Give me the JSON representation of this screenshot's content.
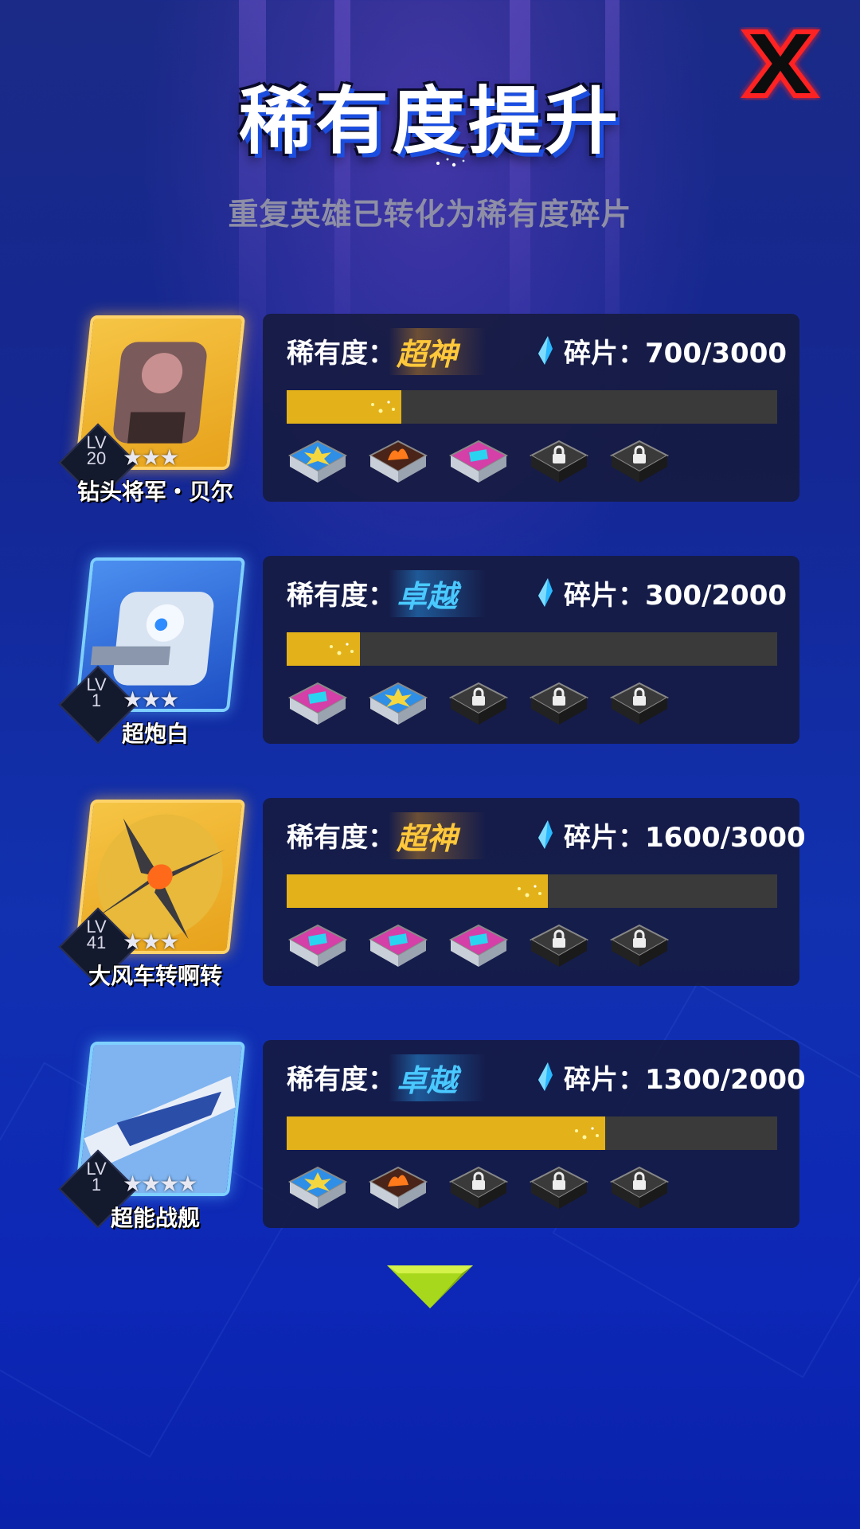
{
  "header": {
    "title": "稀有度提升",
    "subtitle": "重复英雄已转化为稀有度碎片",
    "close_icon": "close-x-icon"
  },
  "colors": {
    "accent_gold": "#ffc83a",
    "accent_blue": "#49c9ff",
    "bar_fill": "#e3b21a",
    "close_red": "#ff2222"
  },
  "rarity_label": "稀有度：",
  "shard_label": "碎片：",
  "heroes": [
    {
      "name": "钻头将军・贝尔",
      "level_prefix": "LV",
      "level": "20",
      "stars": "★★★",
      "frame": "gold",
      "rarity": "超神",
      "shards": "700/3000",
      "progress": 0.233,
      "slots": [
        "blue-burst-icon",
        "fire-tank-icon",
        "pink-rune-icon",
        "lock-icon",
        "lock-icon"
      ]
    },
    {
      "name": "超炮白",
      "level_prefix": "LV",
      "level": "1",
      "stars": "★★★",
      "frame": "blue",
      "rarity": "卓越",
      "shards": "300/2000",
      "progress": 0.15,
      "slots": [
        "pink-rune-icon",
        "blue-burst-icon",
        "lock-icon",
        "lock-icon",
        "lock-icon"
      ]
    },
    {
      "name": "大风车转啊转",
      "level_prefix": "LV",
      "level": "41",
      "stars": "★★★",
      "frame": "gold",
      "rarity": "超神",
      "shards": "1600/3000",
      "progress": 0.533,
      "slots": [
        "pink-rune-icon",
        "pink-rune-icon",
        "pink-rune-icon",
        "lock-icon",
        "lock-icon"
      ]
    },
    {
      "name": "超能战舰",
      "level_prefix": "LV",
      "level": "1",
      "stars": "★★★★",
      "frame": "blue",
      "rarity": "卓越",
      "shards": "1300/2000",
      "progress": 0.65,
      "slots": [
        "blue-burst-icon",
        "fire-tank-icon",
        "lock-icon",
        "lock-icon",
        "lock-icon"
      ]
    }
  ],
  "scroll_indicator": "chevron-down-icon"
}
